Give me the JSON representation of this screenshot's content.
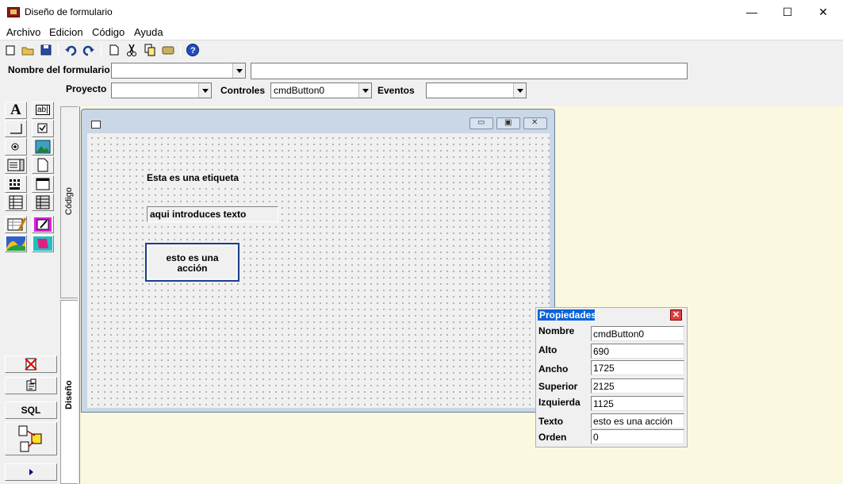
{
  "window": {
    "title": "Diseño de formulario",
    "minimize": "—",
    "maximize": "☐",
    "close": "✕"
  },
  "menu": [
    "Archivo",
    "Edicion",
    "Código",
    "Ayuda"
  ],
  "fields": {
    "form_name_label": "Nombre del formulario",
    "form_name_value": "",
    "project_label": "Proyecto",
    "project_value": "",
    "controls_label": "Controles",
    "controls_value": "cmdButton0",
    "events_label": "Eventos",
    "events_value": ""
  },
  "tabs": {
    "code": "Código",
    "design": "Diseño"
  },
  "toolbox": {
    "sql_label": "SQL",
    "text_tool_label": "A",
    "textbox_tool_label": "ab|"
  },
  "design_form": {
    "label_text": "Esta es una etiqueta",
    "textbox_text": "aqui introduces texto",
    "button_text": "esto es una acción"
  },
  "properties": {
    "title": "Propiedades",
    "rows": [
      {
        "name": "Nombre",
        "value": "cmdButton0"
      },
      {
        "name": "Alto",
        "value": "690"
      },
      {
        "name": "Ancho",
        "value": "1725"
      },
      {
        "name": "Superior",
        "value": "2125"
      },
      {
        "name": "Izquierda",
        "value": "1125"
      },
      {
        "name": "Texto",
        "value": "esto es una acción"
      },
      {
        "name": "Orden",
        "value": "0"
      }
    ]
  },
  "colors": {
    "workspace": "#fbf8e0",
    "accent": "#0a64d8",
    "button_border": "#1a3f8a"
  }
}
